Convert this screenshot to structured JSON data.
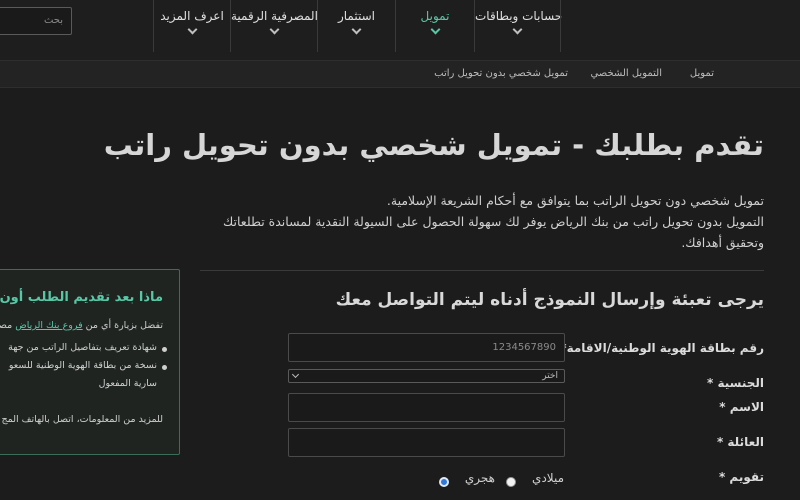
{
  "header": {
    "search_placeholder": "بحث",
    "nav": [
      {
        "label": "حسابات وبطاقات",
        "active": false
      },
      {
        "label": "تمويل",
        "active": true
      },
      {
        "label": "استثمار",
        "active": false
      },
      {
        "label": "المصرفية الرقمية",
        "active": false
      },
      {
        "label": "اعرف المزيد",
        "active": false
      }
    ]
  },
  "breadcrumb": [
    "تمويل",
    "التمويل الشخصي",
    "تمويل شخصي بدون تحويل راتب"
  ],
  "page": {
    "title": "تقدم بطلبك - تمويل شخصي بدون تحويل راتب",
    "intro_line1": "تمويل شخصي دون تحويل الراتب بما يتوافق مع أحكام الشريعة الإسلامية.",
    "intro_line2": "التمويل بدون تحويل راتب من بنك الرياض يوفر لك سهولة الحصول على السيولة النقدية لمساندة تطلعاتك",
    "intro_line3": "وتحقيق أهدافك."
  },
  "form": {
    "heading": "يرجى تعبئة وإرسال النموذج أدناه ليتم التواصل معك",
    "id_label": "رقم بطاقة الهوية الوطنية/الاقامة*",
    "id_placeholder": "1234567890",
    "nationality_label": "الجنسية *",
    "nationality_selected": "اختر",
    "name_label": "الاسم *",
    "family_label": "العائلة *",
    "calendar_label": "تقويم *",
    "calendar_options": [
      "ميلادي",
      "هجري"
    ],
    "calendar_selected": "هجري"
  },
  "side_panel": {
    "title": "ماذا بعد تقديم الطلب أون لاين؟",
    "line1_prefix": "تفضل بزيارة أي من",
    "line1_link": "فروع بنك الرياض",
    "line1_suffix": "مصط",
    "bullet1": "شهادة تعريف بتفاصيل الراتب من جهة",
    "bullet2": "نسخة من بطاقة الهوية الوطنية للسعو",
    "bullet2_cont": "سارية المفعول",
    "footer": "للمزيد من المعلومات، اتصل بالهاتف المج"
  },
  "colors": {
    "accent": "#57c8a6",
    "background": "#1c1c1c",
    "radio_checked": "#2f78d8"
  }
}
